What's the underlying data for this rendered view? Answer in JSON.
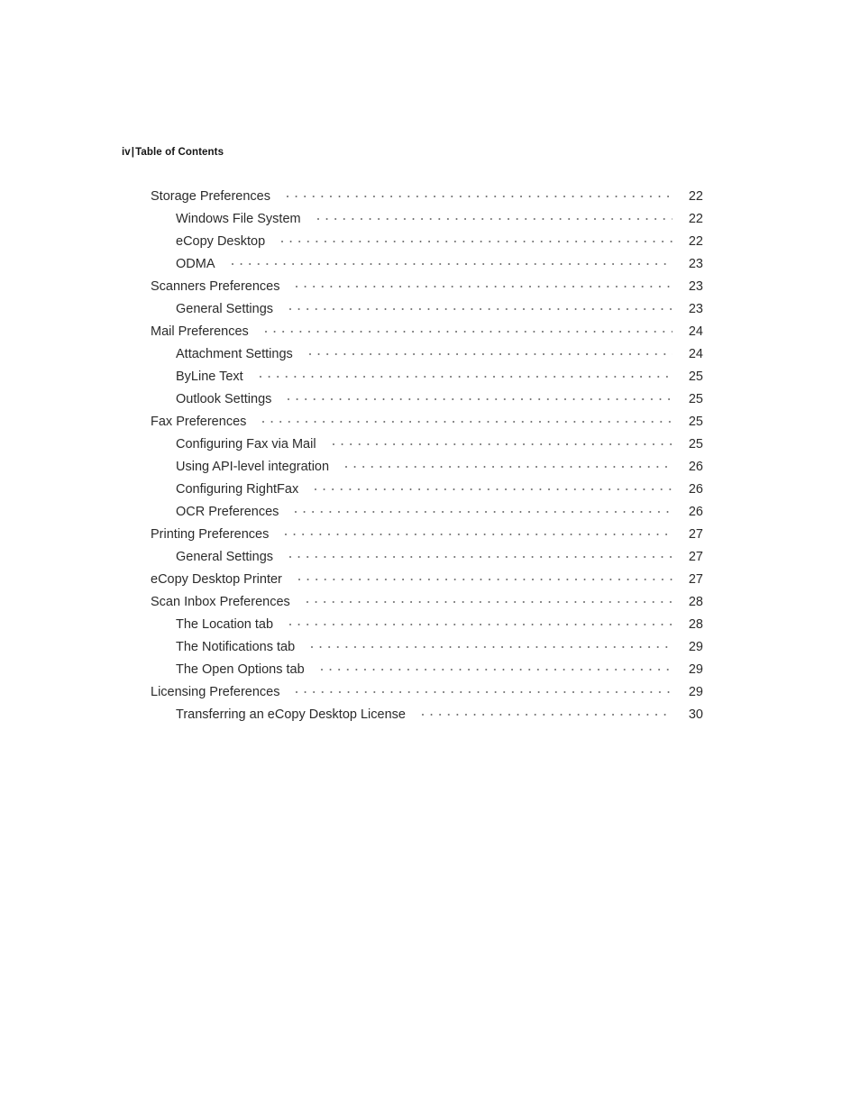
{
  "header": {
    "page_label": "iv",
    "separator": "|",
    "title": "Table of Contents"
  },
  "toc": {
    "entries": [
      {
        "label": "Storage Preferences",
        "page": "22",
        "level": 1
      },
      {
        "label": "Windows File System",
        "page": "22",
        "level": 2
      },
      {
        "label": "eCopy Desktop",
        "page": "22",
        "level": 2
      },
      {
        "label": "ODMA",
        "page": "23",
        "level": 2
      },
      {
        "label": "Scanners Preferences",
        "page": "23",
        "level": 1
      },
      {
        "label": "General Settings",
        "page": "23",
        "level": 2
      },
      {
        "label": "Mail Preferences",
        "page": "24",
        "level": 1
      },
      {
        "label": "Attachment Settings",
        "page": "24",
        "level": 2
      },
      {
        "label": "ByLine Text",
        "page": "25",
        "level": 2
      },
      {
        "label": "Outlook Settings",
        "page": "25",
        "level": 2
      },
      {
        "label": "Fax Preferences",
        "page": "25",
        "level": 1
      },
      {
        "label": "Configuring Fax via Mail",
        "page": "25",
        "level": 2
      },
      {
        "label": "Using API-level integration",
        "page": "26",
        "level": 2
      },
      {
        "label": "Configuring RightFax",
        "page": "26",
        "level": 2
      },
      {
        "label": "OCR Preferences",
        "page": "26",
        "level": 2
      },
      {
        "label": "Printing Preferences",
        "page": "27",
        "level": 1
      },
      {
        "label": "General Settings",
        "page": "27",
        "level": 2
      },
      {
        "label": "eCopy Desktop Printer",
        "page": "27",
        "level": 1
      },
      {
        "label": "Scan Inbox Preferences",
        "page": "28",
        "level": 1
      },
      {
        "label": "The Location tab",
        "page": "28",
        "level": 2
      },
      {
        "label": "The Notifications tab",
        "page": "29",
        "level": 2
      },
      {
        "label": "The Open Options tab",
        "page": "29",
        "level": 2
      },
      {
        "label": "Licensing Preferences",
        "page": "29",
        "level": 1
      },
      {
        "label": "Transferring an eCopy Desktop License",
        "page": "30",
        "level": 2
      }
    ]
  },
  "colors": {
    "text": "#2b2b2b",
    "header_text": "#141414",
    "leader_dots": "#6f6f6f",
    "background": "#ffffff"
  }
}
